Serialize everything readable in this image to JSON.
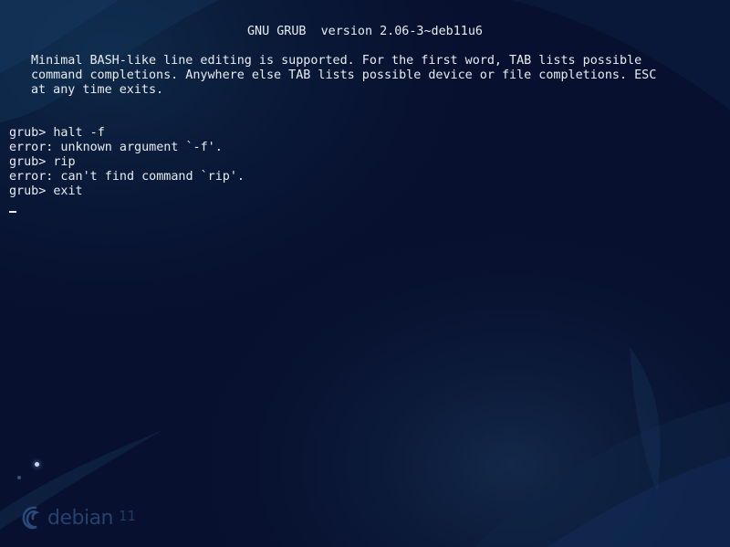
{
  "screen": {
    "header": "GNU GRUB  version 2.06-3~deb11u6",
    "intro": [
      "Minimal BASH-like line editing is supported. For the first word, TAB lists possible",
      "command completions. Anywhere else TAB lists possible device or file completions. ESC",
      "at any time exits."
    ],
    "history": [
      "grub> halt -f",
      "error: unknown argument `-f'.",
      "grub> rip",
      "error: can't find command `rip'.",
      "grub> exit"
    ]
  },
  "wallpaper": {
    "brand": "debian",
    "version": "11",
    "icon": "debian-swirl-icon"
  },
  "colors": {
    "background": "#07102e",
    "text": "#e8ecf2",
    "accent": "#1e3a6a"
  }
}
